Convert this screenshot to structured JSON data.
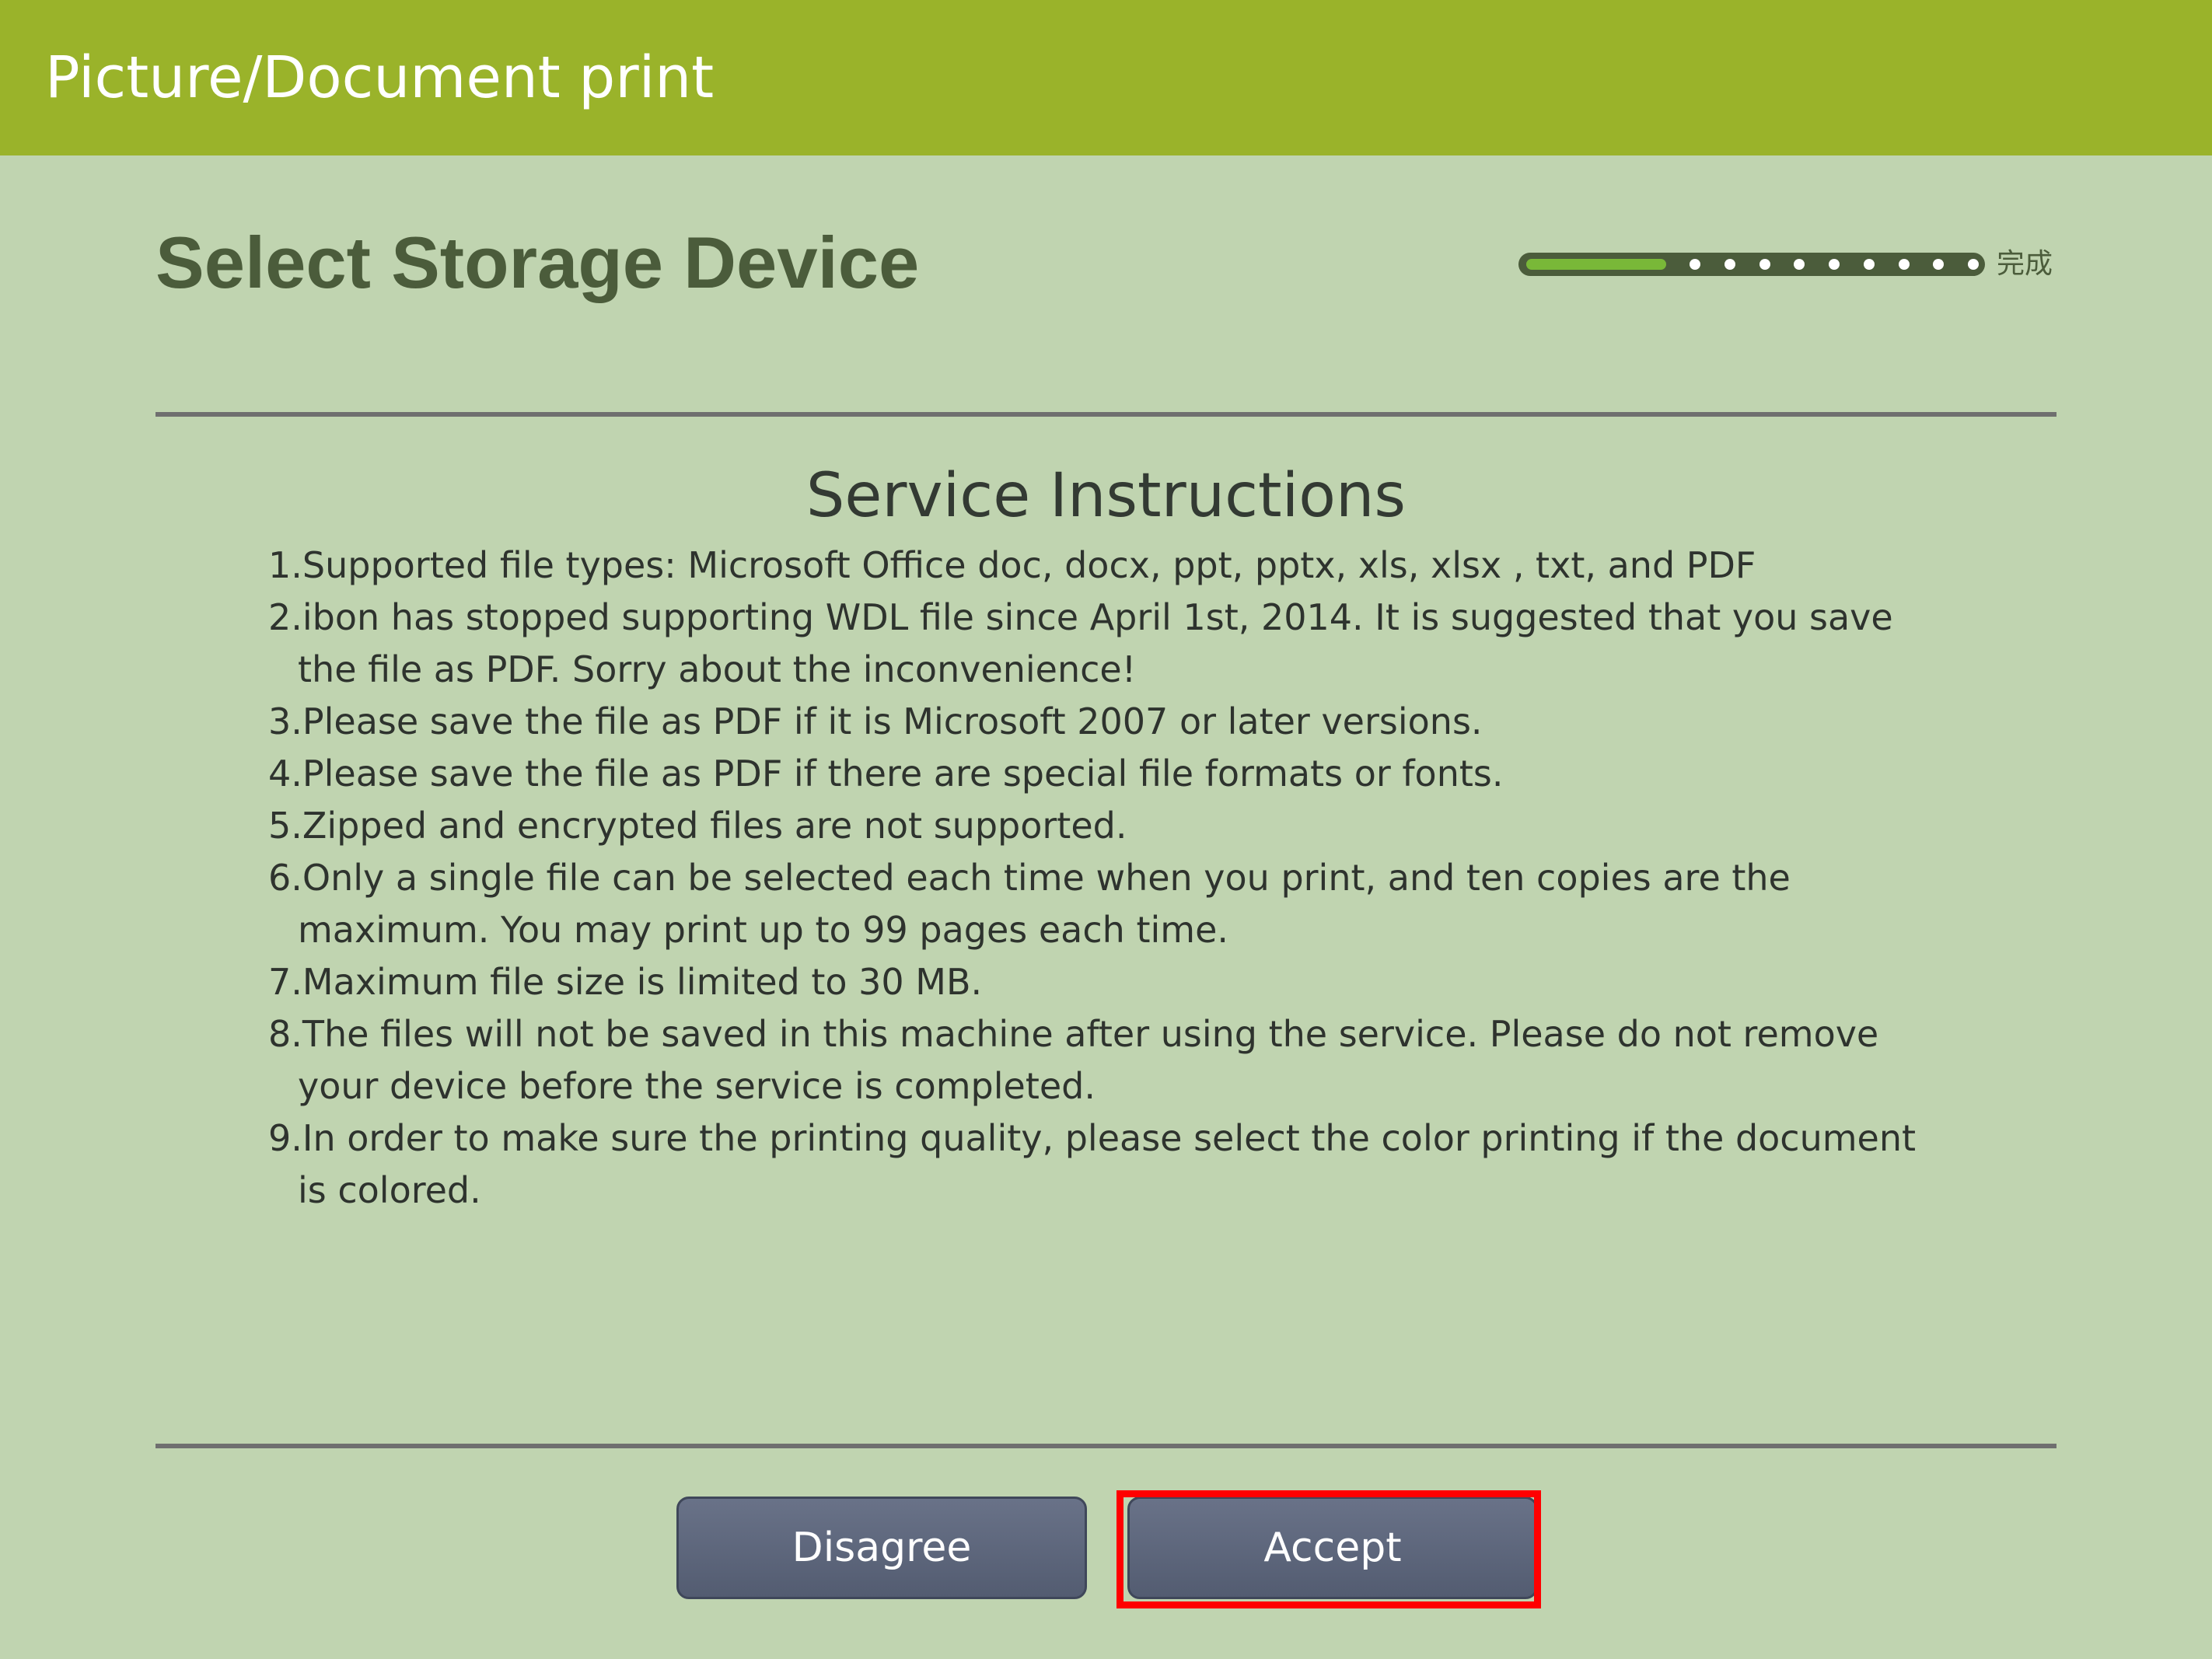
{
  "header": {
    "title": "Picture/Document print"
  },
  "page": {
    "title": "Select Storage Device"
  },
  "progress": {
    "label": "完成",
    "steps_total": 10,
    "steps_completed": 1,
    "accent_color": "#79b838"
  },
  "instructions": {
    "heading": "Service Instructions",
    "items": [
      "1.Supported file types: Microsoft Office doc, docx, ppt, pptx, xls, xlsx , txt, and PDF",
      "2.ibon has stopped supporting WDL file since April 1st, 2014. It is suggested that you save the file as PDF. Sorry about the inconvenience!",
      "3.Please save the file as PDF if it is Microsoft 2007 or later versions.",
      "4.Please save the file as PDF if there are special file formats or fonts.",
      "5.Zipped and encrypted files are not supported.",
      "6.Only a single file can be selected each time when you print, and ten copies are the maximum. You may print up to 99 pages each time.",
      "7.Maximum file size is limited to 30 MB.",
      "8.The files will not be saved in this machine after using the service. Please do not remove your device before the service is completed.",
      "9.In order to make sure the printing quality, please select the color printing if the document is colored."
    ]
  },
  "actions": {
    "disagree_label": "Disagree",
    "accept_label": "Accept"
  },
  "colors": {
    "header_bg": "#9ab32a",
    "page_bg": "#c0d4b0",
    "highlight": "#ff0000"
  }
}
